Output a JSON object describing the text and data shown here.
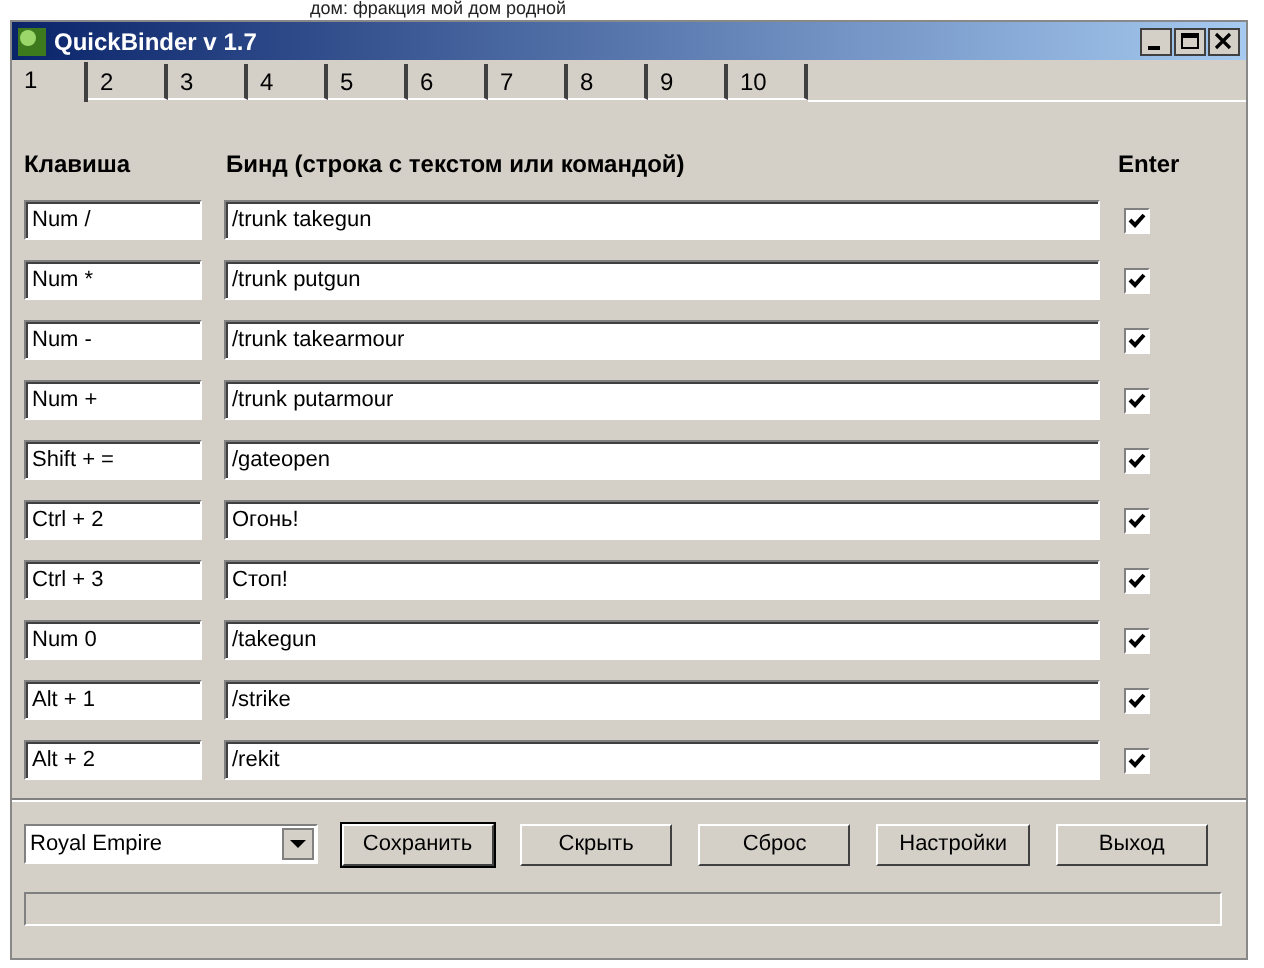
{
  "background_text": "дом: фракция мой дом родной",
  "window": {
    "title": "QuickBinder v 1.7"
  },
  "tabs": [
    {
      "label": "1",
      "selected": true
    },
    {
      "label": "2",
      "selected": false
    },
    {
      "label": "3",
      "selected": false
    },
    {
      "label": "4",
      "selected": false
    },
    {
      "label": "5",
      "selected": false
    },
    {
      "label": "6",
      "selected": false
    },
    {
      "label": "7",
      "selected": false
    },
    {
      "label": "8",
      "selected": false
    },
    {
      "label": "9",
      "selected": false
    },
    {
      "label": "10",
      "selected": false
    }
  ],
  "headers": {
    "key": "Клавиша",
    "bind": "Бинд (строка с текстом или командой)",
    "enter": "Enter"
  },
  "binds": [
    {
      "key": "Num /",
      "text": "/trunk takegun",
      "enter": true
    },
    {
      "key": "Num *",
      "text": "/trunk putgun",
      "enter": true
    },
    {
      "key": "Num -",
      "text": "/trunk takearmour",
      "enter": true
    },
    {
      "key": "Num +",
      "text": "/trunk putarmour",
      "enter": true
    },
    {
      "key": "Shift + =",
      "text": "/gateopen",
      "enter": true
    },
    {
      "key": "Ctrl + 2",
      "text": "Огонь!",
      "enter": true
    },
    {
      "key": "Ctrl + 3",
      "text": "Стоп!",
      "enter": true
    },
    {
      "key": "Num 0",
      "text": "/takegun",
      "enter": true
    },
    {
      "key": "Alt + 1",
      "text": "/strike",
      "enter": true
    },
    {
      "key": "Alt + 2",
      "text": "/rekit",
      "enter": true
    }
  ],
  "server_select": {
    "value": "Royal Empire"
  },
  "buttons": [
    {
      "label": "Сохранить",
      "default": true
    },
    {
      "label": "Скрыть",
      "default": false
    },
    {
      "label": "Сброс",
      "default": false
    },
    {
      "label": "Настройки",
      "default": false
    },
    {
      "label": "Выход",
      "default": false
    }
  ]
}
